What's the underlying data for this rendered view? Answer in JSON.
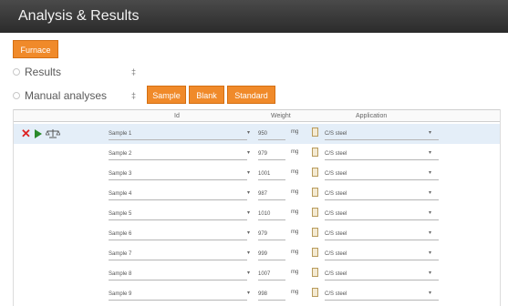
{
  "window": {
    "title": "Analysis & Results"
  },
  "toolbar": {
    "furnace_label": "Furnace"
  },
  "sections": {
    "results": {
      "label": "Results",
      "toggle": "‡"
    },
    "manual": {
      "label": "Manual analyses",
      "toggle": "‡"
    }
  },
  "tabs": [
    {
      "label": "Sample"
    },
    {
      "label": "Blank"
    },
    {
      "label": "Standard"
    }
  ],
  "grid": {
    "headers": {
      "id": "Id",
      "weight": "Weight",
      "application": "Application"
    },
    "rows": [
      {
        "sample": "Sample 1",
        "weight": "950",
        "unit": "mg",
        "application": "C/S steel"
      },
      {
        "sample": "Sample 2",
        "weight": "979",
        "unit": "mg",
        "application": "C/S steel"
      },
      {
        "sample": "Sample 3",
        "weight": "1001",
        "unit": "mg",
        "application": "C/S steel"
      },
      {
        "sample": "Sample 4",
        "weight": "987",
        "unit": "mg",
        "application": "C/S steel"
      },
      {
        "sample": "Sample 5",
        "weight": "1010",
        "unit": "mg",
        "application": "C/S steel"
      },
      {
        "sample": "Sample 6",
        "weight": "979",
        "unit": "mg",
        "application": "C/S steel"
      },
      {
        "sample": "Sample 7",
        "weight": "999",
        "unit": "mg",
        "application": "C/S steel"
      },
      {
        "sample": "Sample 8",
        "weight": "1007",
        "unit": "mg",
        "application": "C/S steel"
      },
      {
        "sample": "Sample 9",
        "weight": "998",
        "unit": "mg",
        "application": "C/S steel"
      }
    ]
  },
  "icons": {
    "delete": "x-icon",
    "run": "play-icon",
    "balance": "scale-icon",
    "file": "file-icon",
    "dropdown": "chevron-down-icon"
  },
  "colors": {
    "accent": "#f08a2a",
    "titlebar": "#2b2b2b",
    "delete": "#dd2222",
    "run": "#2a8a2a"
  }
}
